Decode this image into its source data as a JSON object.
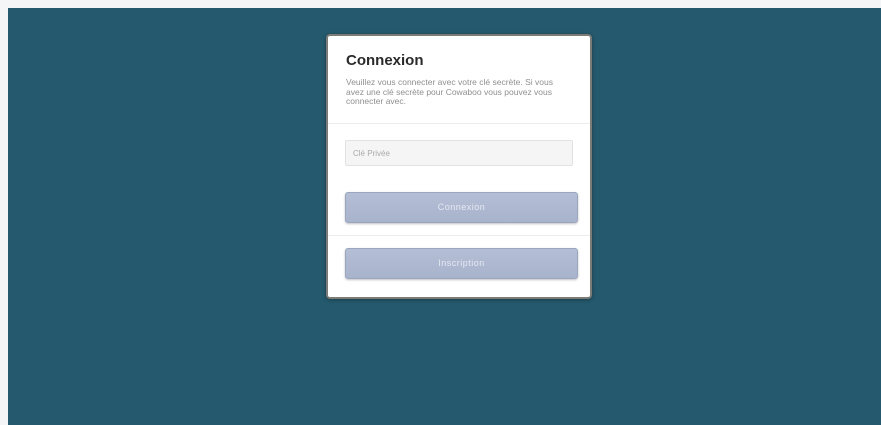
{
  "login": {
    "title": "Connexion",
    "description": "Veuillez vous connecter avec votre clé secrète. Si vous avez une clé secrète pour Cowaboo vous pouvez vous connecter avec.",
    "private_key_placeholder": "Clé Privée",
    "private_key_value": "",
    "login_button_label": "Connexion",
    "register_button_label": "Inscription"
  },
  "colors": {
    "page_background": "#255a6e",
    "button_fill": "#aeb8cf"
  }
}
